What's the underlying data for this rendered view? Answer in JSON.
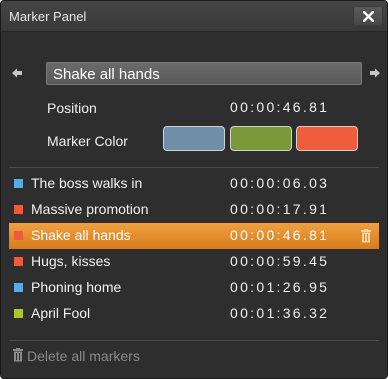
{
  "window": {
    "title": "Marker Panel",
    "close_label": "✕"
  },
  "marker": {
    "name": "Shake all hands",
    "position_label": "Position",
    "position_value": "00:00:46.81",
    "color_label": "Marker Color",
    "colors": [
      "#6f8fa8",
      "#7a9a3a",
      "#ef5d3c"
    ]
  },
  "markers": [
    {
      "name": "The boss walks in",
      "time": "00:00:06.03",
      "color": "#5aaae6",
      "selected": false
    },
    {
      "name": "Massive promotion",
      "time": "00:00:17.91",
      "color": "#ee5a3a",
      "selected": false
    },
    {
      "name": "Shake all hands",
      "time": "00:00:46.81",
      "color": "#ee5a3a",
      "selected": true
    },
    {
      "name": "Hugs, kisses",
      "time": "00:00:59.45",
      "color": "#ee5a3a",
      "selected": false
    },
    {
      "name": "Phoning home",
      "time": "00:01:26.95",
      "color": "#5aaae6",
      "selected": false
    },
    {
      "name": "April Fool",
      "time": "00:01:36.32",
      "color": "#a8c832",
      "selected": false
    }
  ],
  "footer": {
    "delete_all_label": "Delete all markers"
  },
  "icons": {
    "close": "close-icon",
    "prev": "arrow-left-icon",
    "next": "arrow-right-icon",
    "trash": "trash-icon"
  }
}
